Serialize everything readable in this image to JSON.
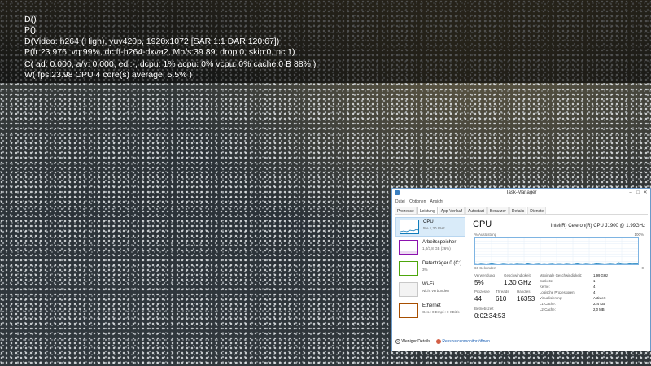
{
  "overlay": {
    "lines": [
      "D()",
      "P()",
      "D(Video: h264 (High), yuv420p, 1920x1072 [SAR 1:1 DAR 120:67])",
      "P(fr:23.976, vq:99%, dc:ff-h264-dxva2, Mb/s:39.89, drop:0, skip:0, pc:1)",
      "C( ad: 0.000, a/v: 0.000, edl:-, dcpu: 1% acpu: 0% vcpu: 0% cache:0  B  88% )",
      "W( fps:23.98 CPU 4 core(s) average: 5.5%  )"
    ]
  },
  "task_manager": {
    "title": "Task-Manager",
    "window_buttons": [
      "–",
      "□",
      "✕"
    ],
    "menu": [
      "Datei",
      "Optionen",
      "Ansicht"
    ],
    "tabs": [
      "Prozesse",
      "Leistung",
      "App-Verlauf",
      "Autostart",
      "Benutzer",
      "Details",
      "Dienste"
    ],
    "active_tab": "Leistung",
    "resources": [
      {
        "name": "CPU",
        "sub": "5% 1,30 GHz",
        "color": "#117dbb"
      },
      {
        "name": "Arbeitsspeicher",
        "sub": "1,0/3,8 GB (26%)",
        "color": "#8b12ae"
      },
      {
        "name": "Datenträger 0 (C:)",
        "sub": "3%",
        "color": "#4da60c"
      },
      {
        "name": "Wi-Fi",
        "sub": "Nicht verbunden",
        "color": "#a0a0a0"
      },
      {
        "name": "Ethernet",
        "sub": "Ges.: 0 Empf.: 0 KBit/s",
        "color": "#a74f01"
      }
    ],
    "detail": {
      "heading": "CPU",
      "model": "Intel(R) Celeron(R) CPU J1900 @ 1.99GHz",
      "graph_top_label": "% Auslastung",
      "graph_top_right": "100%",
      "graph_bottom_left": "60 Sekunden",
      "graph_bottom_right": "0",
      "metrics": [
        {
          "label": "Verwendung",
          "value": "5%"
        },
        {
          "label": "Geschwindigkeit",
          "value": "1,30 GHz"
        },
        {
          "label": "Prozesse",
          "value": "44"
        },
        {
          "label": "Threads",
          "value": "610"
        },
        {
          "label": "Handles",
          "value": "16353"
        },
        {
          "label": "Betriebszeit",
          "value": "0:02:34:53"
        }
      ],
      "info": [
        {
          "label": "Maximale Geschwindigkeit:",
          "value": "1,99 GHz"
        },
        {
          "label": "Sockets:",
          "value": "1"
        },
        {
          "label": "Kerne:",
          "value": "4"
        },
        {
          "label": "Logische Prozessoren:",
          "value": "4"
        },
        {
          "label": "Virtualisierung:",
          "value": "Aktiviert"
        },
        {
          "label": "L1-Cache:",
          "value": "224 KB"
        },
        {
          "label": "L2-Cache:",
          "value": "2,0 MB"
        }
      ],
      "cpu_history_percent": [
        3,
        2,
        4,
        3,
        2,
        3,
        5,
        3,
        2,
        2,
        4,
        3,
        2,
        3,
        2,
        4,
        3,
        3,
        2,
        5,
        3,
        2,
        3,
        4,
        2,
        3,
        2,
        3,
        4,
        2,
        3,
        3,
        2,
        4,
        3,
        2,
        3,
        5,
        3,
        2,
        4,
        3,
        2,
        3,
        5,
        4,
        3,
        2,
        3,
        4,
        3,
        2,
        6,
        4,
        3,
        3,
        5,
        4,
        5,
        5
      ]
    },
    "footer": {
      "less_details": "Weniger Details",
      "resource_monitor": "Ressourcenmonitor öffnen"
    }
  }
}
